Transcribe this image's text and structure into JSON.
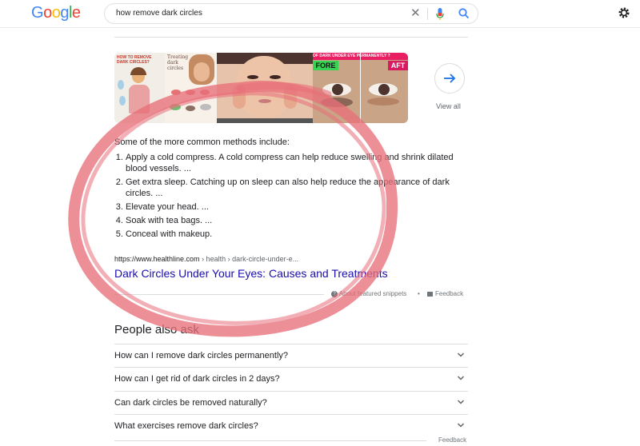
{
  "header": {
    "logo": [
      "G",
      "o",
      "o",
      "g",
      "l",
      "e"
    ],
    "logo_colors": [
      "#4285F4",
      "#EA4335",
      "#FBBC05",
      "#4285F4",
      "#34A853",
      "#EA4335"
    ],
    "search_query": "how remove dark circles"
  },
  "images": {
    "view_all_label": "View all",
    "thumb1_text": "HOW TO REMOVE DARK CIRCLES?",
    "thumb2_text": "Treating dark circles",
    "thumb4_left_text": "FORE",
    "thumb4_right_text": "AFT",
    "thumb4_banner": "OF DARK UNDER EYE PERMANENTLY ?"
  },
  "snippet": {
    "intro": "Some of the more common methods include:",
    "items": [
      "Apply a cold compress. A cold compress can help reduce swelling and shrink dilated blood vessels. ...",
      "Get extra sleep. Catching up on sleep can also help reduce the appearance of dark circles. ...",
      "Elevate your head. ...",
      "Soak with tea bags. ...",
      "Conceal with makeup."
    ],
    "source_domain": "https://www.healthline.com",
    "source_path": " › health › dark-circle-under-e...",
    "title": "Dark Circles Under Your Eyes: Causes and Treatments",
    "about_label": "About featured snippets",
    "separator": "•",
    "feedback_label": "Feedback"
  },
  "paa": {
    "title": "People also ask",
    "questions": [
      "How can I remove dark circles permanently?",
      "How can I get rid of dark circles in 2 days?",
      "Can dark circles be removed naturally?",
      "What exercises remove dark circles?"
    ],
    "feedback_label": "Feedback"
  },
  "colors": {
    "link": "#1a0dab",
    "annotation": "#e8707a"
  }
}
